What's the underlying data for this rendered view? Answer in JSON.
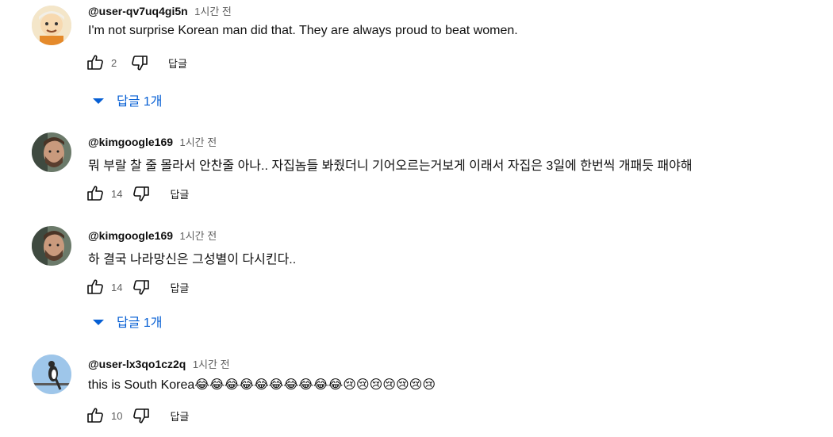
{
  "comments": [
    {
      "author": "@user-qv7uq4gi5n",
      "time": "1시간 전",
      "text": "I'm not surprise Korean man did that. They are always proud to beat women.",
      "likes": "2",
      "reply_label": "답글",
      "replies_label": "답글 1개"
    },
    {
      "author": "@kimgoogle169",
      "time": "1시간 전",
      "text": "뭐 부랄 찰 줄 몰라서 안찬줄 아나.. 자집놈들 봐줬더니 기어오르는거보게 이래서 자집은 3일에 한번씩 개패듯 패야해",
      "likes": "14",
      "reply_label": "답글"
    },
    {
      "author": "@kimgoogle169",
      "time": "1시간 전",
      "text": "하 결국 나라망신은 그성별이 다시킨다..",
      "likes": "14",
      "reply_label": "답글",
      "replies_label": "답글 1개"
    },
    {
      "author": "@user-lx3qo1cz2q",
      "time": "1시간 전",
      "text": "this is South Korea😂😂😂😂😂😂😂😂😂😂😢😢😢😢😢😢😢",
      "likes": "10",
      "reply_label": "답글"
    }
  ],
  "icons": {
    "like": "thumb-up-icon",
    "dislike": "thumb-down-icon",
    "expand": "caret-down-icon"
  },
  "colors": {
    "link_blue": "#065fd4",
    "secondary_text": "#606060"
  }
}
